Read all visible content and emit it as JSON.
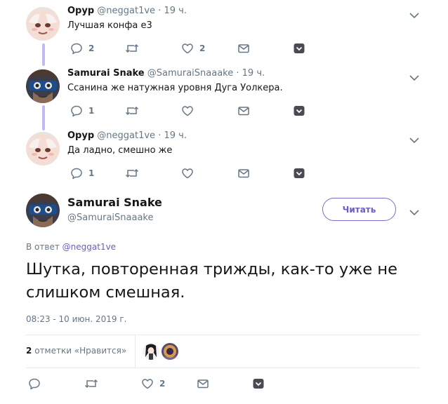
{
  "thread": [
    {
      "author_name": "Орур",
      "handle": "@neggat1ve",
      "time": "· 19 ч.",
      "text": "Лучшая конфа е3",
      "reply_count": "2",
      "retweet_count": "",
      "like_count": "2"
    },
    {
      "author_name": "Samurai Snake",
      "handle": "@SamuraiSnaaake",
      "time": "· 19 ч.",
      "text": "Ссанина же натужная уровня Дуга Уолкера.",
      "reply_count": "1",
      "retweet_count": "",
      "like_count": ""
    },
    {
      "author_name": "Орур",
      "handle": "@neggat1ve",
      "time": "· 19 ч.",
      "text": "Да ладно, смешно же",
      "reply_count": "1",
      "retweet_count": "",
      "like_count": ""
    }
  ],
  "main_tweet": {
    "author_name": "Samurai Snake",
    "handle": "@SamuraiSnaaake",
    "follow_label": "Читать",
    "reply_to_prefix": "В ответ",
    "reply_to_handle": "@neggat1ve",
    "text": "Шутка, повторенная трижды, как-то уже не слишком смешная.",
    "datetime": "08:23 - 10 июн. 2019 г.",
    "likes_count": "2",
    "likes_label": "отметки «Нравится»",
    "reply_count": "",
    "retweet_count": "",
    "like_count": "2"
  },
  "colors": {
    "accent": "#6b5cc6",
    "thread_line": "#c4b9f2",
    "muted": "#657786"
  }
}
